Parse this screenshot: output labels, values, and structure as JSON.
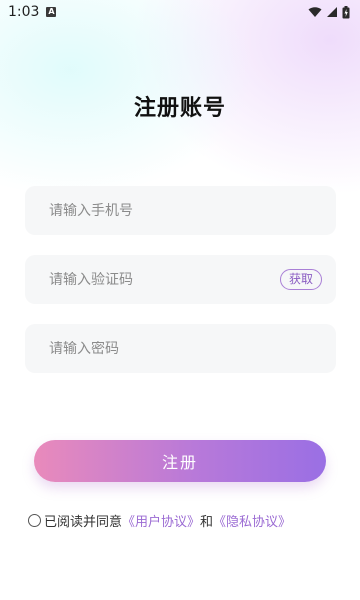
{
  "status_bar": {
    "time": "1:03",
    "notification_icon": "a-icon"
  },
  "page": {
    "title": "注册账号"
  },
  "form": {
    "phone_placeholder": "请输入手机号",
    "code_placeholder": "请输入验证码",
    "get_code_label": "获取",
    "password_placeholder": "请输入密码",
    "submit_label": "注册"
  },
  "agreement": {
    "prefix": "已阅读并同意",
    "user_agreement": "《用户协议》",
    "and": "和",
    "privacy_agreement": "《隐私协议》"
  },
  "colors": {
    "accent": "#9b6bd3",
    "button_start": "#e98abb",
    "button_end": "#9a6fe4",
    "field_bg": "#f6f7f8"
  }
}
